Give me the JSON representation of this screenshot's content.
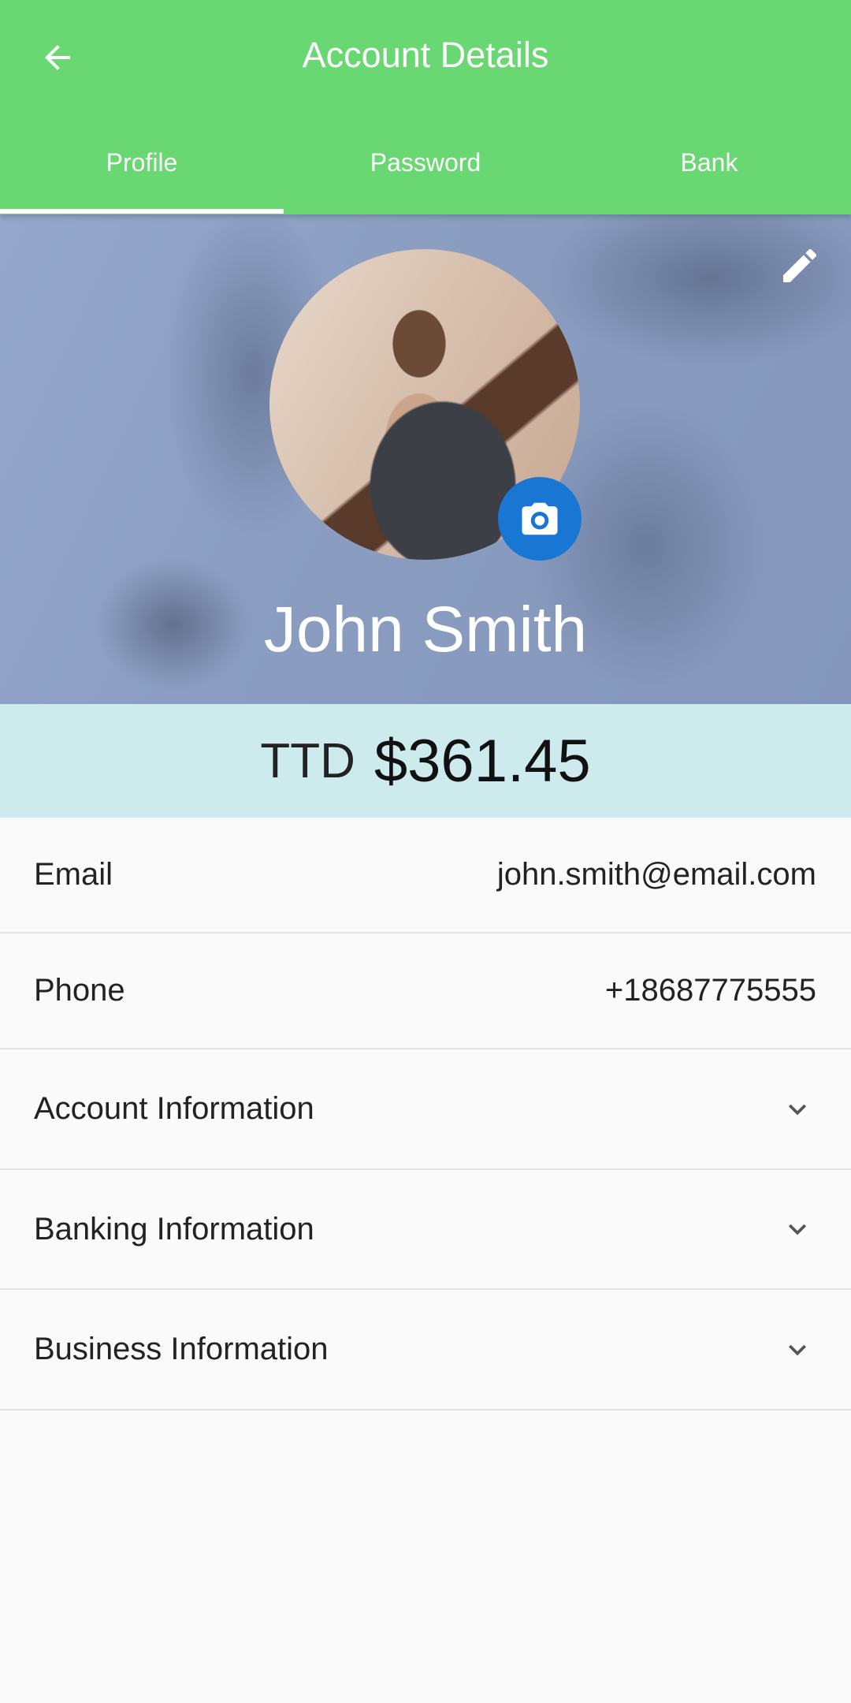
{
  "header": {
    "title": "Account Details",
    "back_icon": "arrow-left-icon"
  },
  "tabs": [
    {
      "label": "Profile",
      "active": true
    },
    {
      "label": "Password",
      "active": false
    },
    {
      "label": "Bank",
      "active": false
    }
  ],
  "profile": {
    "name": "John Smith",
    "edit_icon": "pencil-icon",
    "camera_icon": "camera-icon"
  },
  "balance": {
    "currency": "TTD",
    "amount": "$361.45"
  },
  "details": {
    "email_label": "Email",
    "email_value": "john.smith@email.com",
    "phone_label": "Phone",
    "phone_value": "+18687775555"
  },
  "sections": [
    {
      "label": "Account Information"
    },
    {
      "label": "Banking Information"
    },
    {
      "label": "Business Information"
    }
  ],
  "colors": {
    "app_bar": "#69d873",
    "camera_button": "#1976d2",
    "balance_bar": "#cdeaed"
  }
}
